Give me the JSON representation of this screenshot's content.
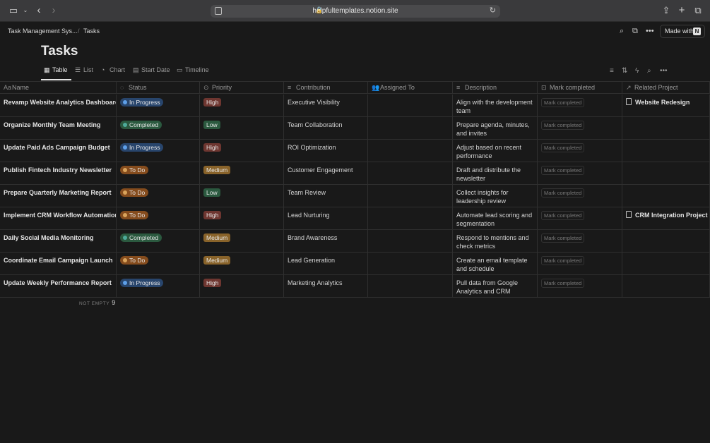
{
  "browser": {
    "url": "helpfultemplates.notion.site",
    "icons": [
      "sidebar-icon",
      "chevron-down-icon",
      "back-arrow-icon",
      "forward-arrow-icon",
      "reader-icon",
      "lock-icon",
      "reload-icon",
      "share-icon",
      "new-tab-icon",
      "tabs-overview-icon"
    ]
  },
  "topbar": {
    "breadcrumb": [
      "Task Management Sys...",
      "Tasks"
    ],
    "breadcrumb_separator": "/",
    "made_with_label": "Made with",
    "made_with_logo": "N"
  },
  "page": {
    "title": "Tasks"
  },
  "views": [
    {
      "label": "Table",
      "icon": "table-icon",
      "active": true
    },
    {
      "label": "List",
      "icon": "list-icon",
      "active": false
    },
    {
      "label": "Chart",
      "icon": "chart-icon",
      "active": false
    },
    {
      "label": "Start Date",
      "icon": "calendar-icon",
      "active": false
    },
    {
      "label": "Timeline",
      "icon": "timeline-icon",
      "active": false
    }
  ],
  "columns": [
    {
      "label": "Name",
      "icon": "text-icon",
      "icon_glyph": "Aa"
    },
    {
      "label": "Status",
      "icon": "status-icon",
      "icon_glyph": "◌"
    },
    {
      "label": "Priority",
      "icon": "select-icon",
      "icon_glyph": "⊙"
    },
    {
      "label": "Contribution",
      "icon": "text-lines-icon",
      "icon_glyph": "≡"
    },
    {
      "label": "Assigned To",
      "icon": "people-icon",
      "icon_glyph": "👥"
    },
    {
      "label": "Description",
      "icon": "text-lines-icon",
      "icon_glyph": "≡"
    },
    {
      "label": "Mark completed",
      "icon": "button-icon",
      "icon_glyph": "⊡"
    },
    {
      "label": "Related Project",
      "icon": "relation-arrow-icon",
      "icon_glyph": "↗"
    }
  ],
  "colors": {
    "in_progress_bg": "#28456c",
    "in_progress_dot": "#5e9fe8",
    "completed_bg": "#2b593f",
    "completed_dot": "#4dab9a",
    "todo_bg": "#854c1d",
    "todo_dot": "#d9a35b",
    "high_bg": "#6e3630",
    "medium_bg": "#89632a",
    "low_bg": "#2b593f"
  },
  "rows": [
    {
      "name": "Revamp Website Analytics Dashboard",
      "status": "In Progress",
      "priority": "High",
      "contribution": "Executive Visibility",
      "assigned_to": "",
      "description": "Align with the development team",
      "mark": "Mark completed",
      "related": "Website Redesign"
    },
    {
      "name": "Organize Monthly Team Meeting",
      "status": "Completed",
      "priority": "Low",
      "contribution": "Team Collaboration",
      "assigned_to": "",
      "description": "Prepare agenda, minutes, and invites",
      "mark": "Mark completed",
      "related": ""
    },
    {
      "name": "Update Paid Ads Campaign Budget",
      "status": "In Progress",
      "priority": "High",
      "contribution": "ROI Optimization",
      "assigned_to": "",
      "description": "Adjust based on recent performance",
      "mark": "Mark completed",
      "related": ""
    },
    {
      "name": "Publish Fintech Industry Newsletter",
      "status": "To Do",
      "priority": "Medium",
      "contribution": "Customer Engagement",
      "assigned_to": "",
      "description": "Draft and distribute the newsletter",
      "mark": "Mark completed",
      "related": ""
    },
    {
      "name": "Prepare Quarterly Marketing Report",
      "status": "To Do",
      "priority": "Low",
      "contribution": "Team Review",
      "assigned_to": "",
      "description": "Collect insights for leadership review",
      "mark": "Mark completed",
      "related": ""
    },
    {
      "name": "Implement CRM Workflow Automation",
      "status": "To Do",
      "priority": "High",
      "contribution": "Lead Nurturing",
      "assigned_to": "",
      "description": "Automate lead scoring and segmentation",
      "mark": "Mark completed",
      "related": "CRM Integration Project"
    },
    {
      "name": "Daily Social Media Monitoring",
      "status": "Completed",
      "priority": "Medium",
      "contribution": "Brand Awareness",
      "assigned_to": "",
      "description": "Respond to mentions and check metrics",
      "mark": "Mark completed",
      "related": ""
    },
    {
      "name": "Coordinate Email Campaign Launch",
      "status": "To Do",
      "priority": "Medium",
      "contribution": "Lead Generation",
      "assigned_to": "",
      "description": "Create an email template and schedule",
      "mark": "Mark completed",
      "related": ""
    },
    {
      "name": "Update Weekly Performance Report",
      "status": "In Progress",
      "priority": "High",
      "contribution": "Marketing Analytics",
      "assigned_to": "",
      "description": "Pull data from Google Analytics and CRM",
      "mark": "Mark completed",
      "related": ""
    }
  ],
  "calculation": {
    "label": "NOT EMPTY",
    "value": "9"
  }
}
